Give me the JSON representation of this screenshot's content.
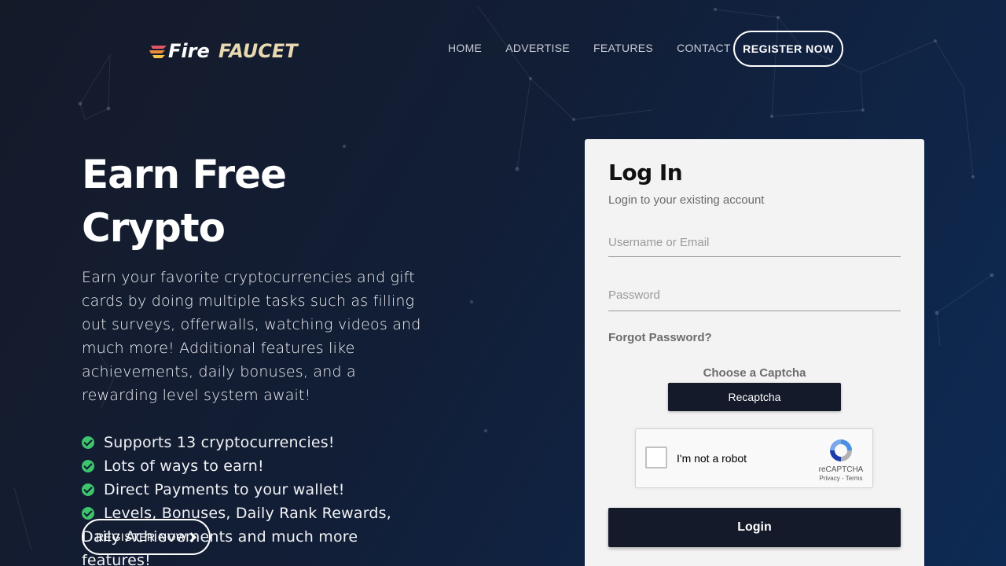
{
  "logo": {
    "part1": "Fire",
    "part2": "FAUCET"
  },
  "nav": {
    "items": [
      "HOME",
      "ADVERTISE",
      "FEATURES",
      "CONTACT"
    ],
    "register": "REGISTER NOW"
  },
  "hero": {
    "title": "Earn Free Crypto",
    "description": "Earn your favorite cryptocurrencies and gift cards by doing multiple tasks such as filling out surveys, offerwalls, watching videos and much more! Additional features like achievements, daily bonuses, and a rewarding level system await!",
    "features": [
      "Supports 13 cryptocurrencies!",
      "Lots of ways to earn!",
      "Direct Payments to your wallet!",
      "Levels, Bonuses, Daily Rank Rewards, Daily Achievements and much more features!"
    ],
    "register": "REGISTER NOW"
  },
  "login": {
    "title": "Log In",
    "subtitle": "Login to your existing account",
    "username_placeholder": "Username or Email",
    "password_placeholder": "Password",
    "forgot": "Forgot Password?",
    "captcha_label": "Choose a Captcha",
    "captcha_selected": "Recaptcha",
    "recaptcha_text": "I'm not a robot",
    "recaptcha_brand": "reCAPTCHA",
    "recaptcha_links": "Privacy - Terms",
    "button": "Login"
  },
  "colors": {
    "accent_dark": "#141a29",
    "check_green": "#3ec46d",
    "logo_gold": "#e8d9b0"
  }
}
